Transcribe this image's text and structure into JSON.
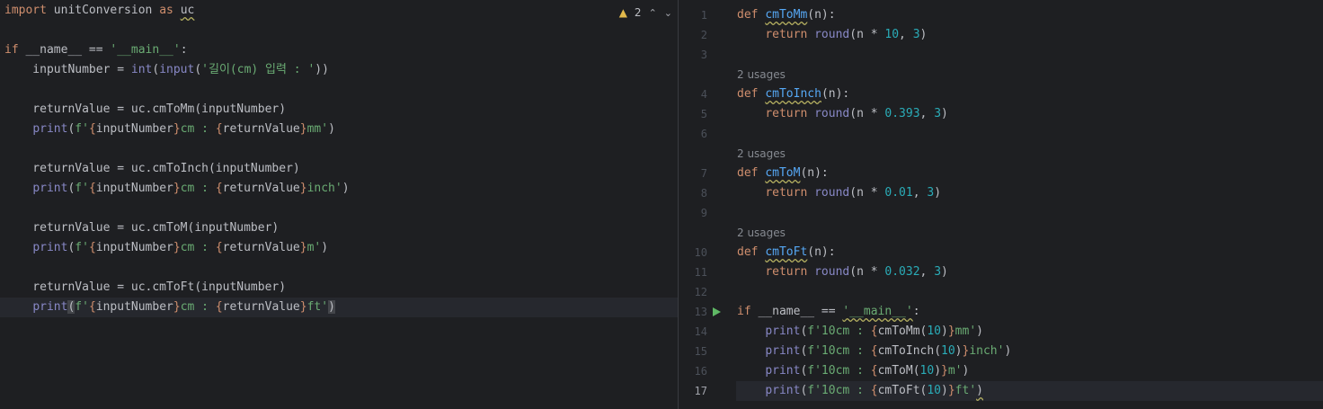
{
  "left_editor": {
    "inspection": {
      "warning_count": "2",
      "prev_label": "⌃",
      "next_label": "⌄"
    },
    "lines": {
      "l1": {
        "kw": "import",
        "mod": " unitConversion ",
        "kw2": "as",
        "alias": "uc"
      },
      "l3": {
        "kw": "if",
        "a": " __name__ == ",
        "s": "'__main__'",
        "b": ":"
      },
      "l4": {
        "a": "    inputNumber = ",
        "f1": "int",
        "p1": "(",
        "f2": "input",
        "p2": "(",
        "s": "'길이(cm) 입력 : '",
        "p3": "))"
      },
      "l6": {
        "a": "    returnValue = uc.cmToMm(inputNumber)"
      },
      "l7": {
        "f": "print",
        "p": "(",
        "s1": "f'",
        "b1": "{",
        "v1": "inputNumber",
        "b2": "}",
        "s2": "cm : ",
        "b3": "{",
        "v2": "returnValue",
        "b4": "}",
        "s3": "mm'",
        "e": ")"
      },
      "l9": {
        "a": "    returnValue = uc.cmToInch(inputNumber)"
      },
      "l10": {
        "f": "print",
        "p": "(",
        "s1": "f'",
        "b1": "{",
        "v1": "inputNumber",
        "b2": "}",
        "s2": "cm : ",
        "b3": "{",
        "v2": "returnValue",
        "b4": "}",
        "s3": "inch'",
        "e": ")"
      },
      "l12": {
        "a": "    returnValue = uc.cmToM(inputNumber)"
      },
      "l13": {
        "f": "print",
        "p": "(",
        "s1": "f'",
        "b1": "{",
        "v1": "inputNumber",
        "b2": "}",
        "s2": "cm : ",
        "b3": "{",
        "v2": "returnValue",
        "b4": "}",
        "s3": "m'",
        "e": ")"
      },
      "l15": {
        "a": "    returnValue = uc.cmToFt(inputNumber)"
      },
      "l16": {
        "f": "print",
        "p": "(",
        "s1": "f'",
        "b1": "{",
        "v1": "inputNumber",
        "b2": "}",
        "s2": "cm : ",
        "b3": "{",
        "v2": "returnValue",
        "b4": "}",
        "s3": "ft'",
        "e": ")"
      }
    }
  },
  "right_editor": {
    "line_numbers": [
      "1",
      "2",
      "3",
      "4",
      "5",
      "6",
      "7",
      "8",
      "9",
      "10",
      "11",
      "12",
      "13",
      "14",
      "15",
      "16",
      "17"
    ],
    "usages_label": "2 usages",
    "defs": {
      "d1": {
        "kw": "def",
        "name": "cmToMm",
        "sig": "(n):",
        "ret": "return",
        "fn": "round",
        "a": "(n * ",
        "num": "10",
        "c": ", ",
        "num2": "3",
        "e": ")"
      },
      "d2": {
        "kw": "def",
        "name": "cmToInch",
        "sig": "(n):",
        "ret": "return",
        "fn": "round",
        "a": "(n * ",
        "num": "0.393",
        "c": ", ",
        "num2": "3",
        "e": ")"
      },
      "d3": {
        "kw": "def",
        "name": "cmToM",
        "sig": "(n):",
        "ret": "return",
        "fn": "round",
        "a": "(n * ",
        "num": "0.01",
        "c": ", ",
        "num2": "3",
        "e": ")"
      },
      "d4": {
        "kw": "def",
        "name": "cmToFt",
        "sig": "(n):",
        "ret": "return",
        "fn": "round",
        "a": "(n * ",
        "num": "0.032",
        "c": ", ",
        "num2": "3",
        "e": ")"
      }
    },
    "main": {
      "kw": "if",
      "a": " __name__ == ",
      "s": "'__main__'",
      "b": ":"
    },
    "prints": {
      "p1": {
        "f": "print",
        "p": "(",
        "s1": "f'10cm : ",
        "b1": "{",
        "call": "cmToMm",
        "o": "(",
        "n": "10",
        "c": ")",
        "b2": "}",
        "s2": "mm'",
        "e": ")"
      },
      "p2": {
        "f": "print",
        "p": "(",
        "s1": "f'10cm : ",
        "b1": "{",
        "call": "cmToInch",
        "o": "(",
        "n": "10",
        "c": ")",
        "b2": "}",
        "s2": "inch'",
        "e": ")"
      },
      "p3": {
        "f": "print",
        "p": "(",
        "s1": "f'10cm : ",
        "b1": "{",
        "call": "cmToM",
        "o": "(",
        "n": "10",
        "c": ")",
        "b2": "}",
        "s2": "m'",
        "e": ")"
      },
      "p4": {
        "f": "print",
        "p": "(",
        "s1": "f'10cm : ",
        "b1": "{",
        "call": "cmToFt",
        "o": "(",
        "n": "10",
        "c": ")",
        "b2": "}",
        "s2": "ft'",
        "e": ")"
      }
    }
  },
  "colors": {
    "background": "#1e1f22",
    "keyword": "#cf8e6d",
    "function_name": "#56a8f5",
    "builtin": "#8888c6",
    "string": "#6aab73",
    "number": "#2aacb8",
    "warning": "#e2b94b",
    "run": "#5fb865"
  }
}
